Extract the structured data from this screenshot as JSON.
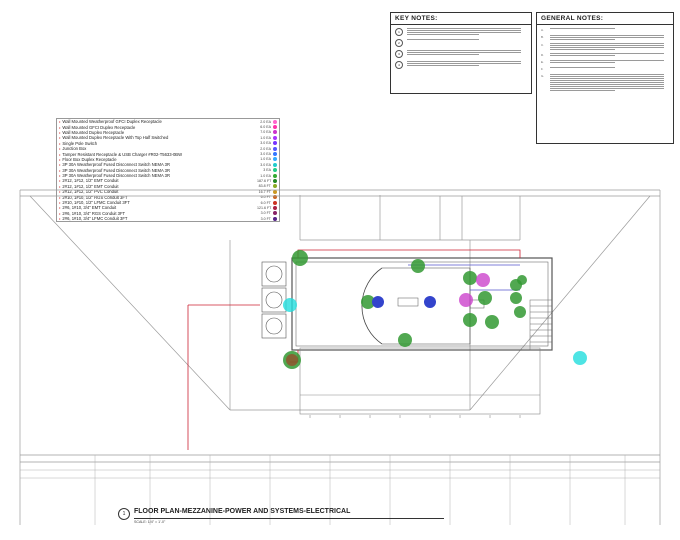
{
  "key_notes": {
    "title": "KEY NOTES:",
    "items": [
      {
        "num": "1",
        "lines": 4
      },
      {
        "num": "2",
        "lines": 1
      },
      {
        "num": "3",
        "lines": 3
      },
      {
        "num": "4",
        "lines": 3
      }
    ]
  },
  "general_notes": {
    "title": "GENERAL NOTES:",
    "items": [
      {
        "num": "A.",
        "lines": 1
      },
      {
        "num": "B.",
        "lines": 3
      },
      {
        "num": "C.",
        "lines": 4
      },
      {
        "num": "D.",
        "lines": 2
      },
      {
        "num": "E.",
        "lines": 2
      },
      {
        "num": "F.",
        "lines": 1
      },
      {
        "num": "G.",
        "lines": 9
      }
    ]
  },
  "legend": {
    "items": [
      {
        "label": "Wall Mounted Weatherproof GFCI Duplex Receptacle",
        "qty": "2.0 EA",
        "color": "#ff66cc"
      },
      {
        "label": "Wall Mounted GFCI Duplex Receptacle",
        "qty": "6.0 EA",
        "color": "#ff33aa"
      },
      {
        "label": "Wall Mounted Duplex Receptacle",
        "qty": "7.0 EA",
        "color": "#cc33cc"
      },
      {
        "label": "Wall Mounted Duplex Receptacle With Top Half Switched",
        "qty": "1.0 EA",
        "color": "#aa33ff"
      },
      {
        "label": "Single Pole Switch",
        "qty": "3.0 EA",
        "color": "#7733ff"
      },
      {
        "label": "Junction Box",
        "qty": "2.0 EA",
        "color": "#5555ff"
      },
      {
        "label": "Tamper Resistant Receptacle & USB Charger #R02-T5633-0BW",
        "qty": "3.0 EA",
        "color": "#3377ff"
      },
      {
        "label": "Floor Box Duplex Receptacle",
        "qty": "1.0 EA",
        "color": "#33aaff"
      },
      {
        "label": "3P 30A Weatherproof Fused Disconnect Switch NEMA 3R",
        "qty": "3.0 EA",
        "color": "#22cccc"
      },
      {
        "label": "3P 30A Weatherproof Fused Disconnect Switch NEMA 3R",
        "qty": "3 EA",
        "color": "#22cc88"
      },
      {
        "label": "3P 30A Weatherproof Fused Disconnect Switch NEMA 3R",
        "qty": "1.0 EA",
        "color": "#33aa33"
      },
      {
        "label": "2#12, 1#12, 1/2\" EMT Conduit",
        "qty": "187.6 FT",
        "color": "#228822"
      },
      {
        "label": "2#12, 1#12, 1/2\" EMT Conduit",
        "qty": "83.8 FT",
        "color": "#88aa22"
      },
      {
        "label": "2#12, 1#12, 1/2\" PVC Conduit",
        "qty": "16.7 FT",
        "color": "#cc9922"
      },
      {
        "label": "2#10, 1#10, 1/2\" RGS Conduit 3FT",
        "qty": "6.0 FT",
        "color": "#cc6622"
      },
      {
        "label": "2#10, 1#10, 1/2\" LFMC Conduit 3FT",
        "qty": "6.0 FT",
        "color": "#cc3322"
      },
      {
        "label": "2#6, 1#10, 3/4\" EMT Conduit",
        "qty": "121.6 FT",
        "color": "#aa2244"
      },
      {
        "label": "2#6, 1#10, 3/4\" RGS Conduit 3FT",
        "qty": "3.0 FT",
        "color": "#882266"
      },
      {
        "label": "2#6, 1#10, 3/4\" LFMC Conduit 3FT",
        "qty": "3.0 FT",
        "color": "#552288"
      }
    ]
  },
  "drawing": {
    "title": "FLOOR PLAN-MEZZANINE-POWER AND SYSTEMS-ELECTRICAL",
    "number": "1",
    "scale": "SCALE: 1/4\" = 1'-0\""
  }
}
